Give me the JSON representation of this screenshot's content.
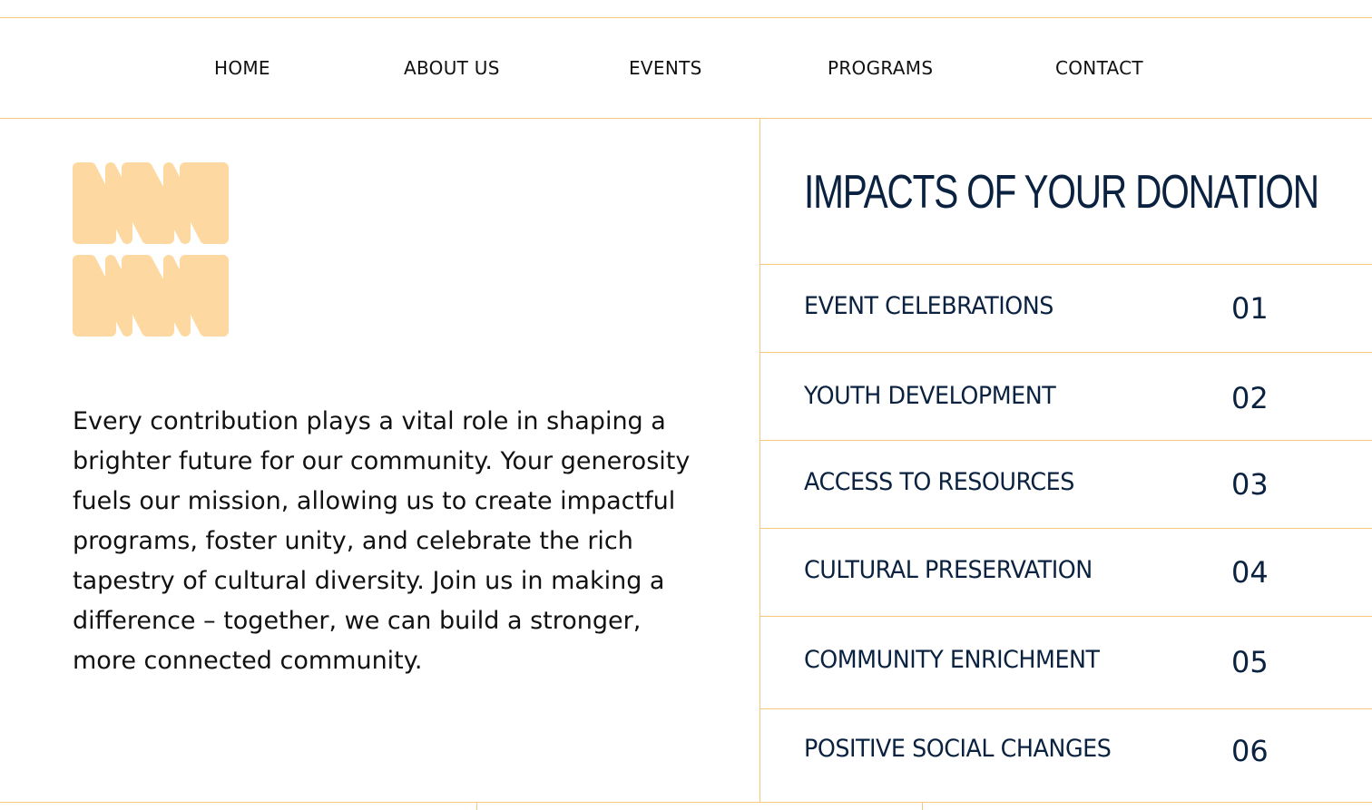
{
  "nav": {
    "items": [
      {
        "label": "HOME"
      },
      {
        "label": "ABOUT US"
      },
      {
        "label": "EVENTS"
      },
      {
        "label": "PROGRAMS"
      },
      {
        "label": "CONTACT"
      }
    ]
  },
  "logo": {
    "icon": "nn-logo-mark",
    "color": "#fdd9a1"
  },
  "intro": {
    "text": "Every contribution plays a vital role in shaping a brighter future for our community. Your generosity fuels our mission, allowing us to create impactful programs, foster unity, and celebrate the rich tapestry of cultural diversity. Join us in making a difference – together, we can build a stronger, more connected community."
  },
  "impacts": {
    "title": "IMPACTS OF YOUR DONATION",
    "items": [
      {
        "label": "EVENT CELEBRATIONS",
        "number": "01"
      },
      {
        "label": "YOUTH DEVELOPMENT",
        "number": "02"
      },
      {
        "label": "ACCESS TO RESOURCES",
        "number": "03"
      },
      {
        "label": "CULTURAL PRESERVATION",
        "number": "04"
      },
      {
        "label": "COMMUNITY ENRICHMENT",
        "number": "05"
      },
      {
        "label": "POSITIVE SOCIAL CHANGES",
        "number": "06"
      }
    ]
  },
  "colors": {
    "accent_line": "#f5c77a",
    "text_navy": "#0a2240",
    "logo_fill": "#fdd9a1"
  }
}
